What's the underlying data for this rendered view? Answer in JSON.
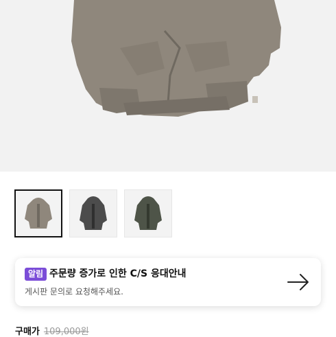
{
  "product": {
    "image_alt": "hoodie product image",
    "thumbnails": [
      {
        "color": "#8f877c",
        "icon": "hoodie-thumbnail-beige"
      },
      {
        "color": "#4c4c4c",
        "icon": "hoodie-thumbnail-charcoal"
      },
      {
        "color": "#4e5448",
        "icon": "hoodie-thumbnail-olive"
      }
    ]
  },
  "notice": {
    "badge": "알림",
    "title": "주문량 증가로 인한 C/S 응대안내",
    "subtitle": "게시판 문의로 요청해주세요."
  },
  "price": {
    "label": "구매가",
    "original": "109,000원"
  },
  "colors": {
    "badge": "#7b4dd8",
    "hero_bg": "#f2f2f2"
  }
}
